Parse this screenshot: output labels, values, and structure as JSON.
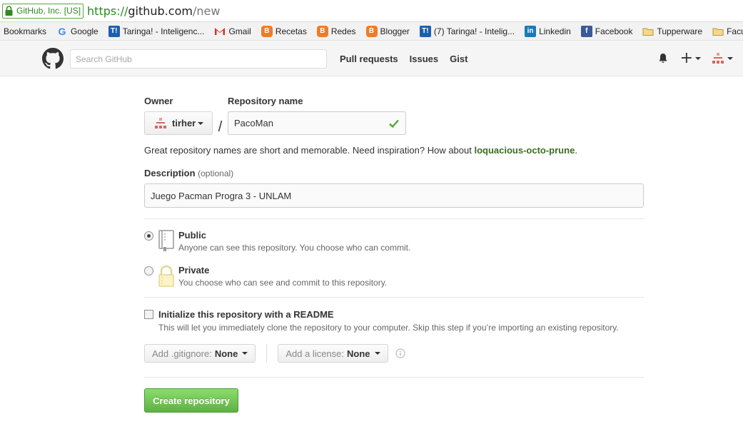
{
  "browser": {
    "security_label": "GitHub, Inc. [US]",
    "url_scheme": "https://",
    "url_host": "github.com",
    "url_path": "/new"
  },
  "bookmarks": [
    {
      "label": "Bookmarks",
      "icon": "none"
    },
    {
      "label": "Google",
      "icon": "google-icon"
    },
    {
      "label": "Taringa! - Inteligenc...",
      "icon": "taringa-icon"
    },
    {
      "label": "Gmail",
      "icon": "gmail-icon"
    },
    {
      "label": "Recetas",
      "icon": "blogger-icon"
    },
    {
      "label": "Redes",
      "icon": "blogger-icon"
    },
    {
      "label": "Blogger",
      "icon": "blogger-icon"
    },
    {
      "label": "(7) Taringa! - Intelig...",
      "icon": "taringa-icon"
    },
    {
      "label": "Linkedin",
      "icon": "linkedin-icon"
    },
    {
      "label": "Facebook",
      "icon": "facebook-icon"
    },
    {
      "label": "Tupperware",
      "icon": "folder-icon"
    },
    {
      "label": "Facult",
      "icon": "folder-icon"
    }
  ],
  "header": {
    "search_placeholder": "Search GitHub",
    "nav": [
      "Pull requests",
      "Issues",
      "Gist"
    ]
  },
  "form": {
    "owner_label": "Owner",
    "owner_value": "tirher",
    "repo_label": "Repository name",
    "repo_value": "PacoMan",
    "slash": "/",
    "hint_text": "Great repository names are short and memorable. Need inspiration? How about ",
    "hint_suggestion": "loquacious-octo-prune",
    "hint_end": ".",
    "description_label": "Description",
    "description_optional": "(optional)",
    "description_value": "Juego Pacman Progra 3 - UNLAM",
    "public_title": "Public",
    "public_desc": "Anyone can see this repository. You choose who can commit.",
    "private_title": "Private",
    "private_desc": "You choose who can see and commit to this repository.",
    "visibility_selected": "Public",
    "readme_title": "Initialize this repository with a README",
    "readme_desc": "This will let you immediately clone the repository to your computer. Skip this step if you’re importing an existing repository.",
    "readme_checked": false,
    "gitignore_label": "Add .gitignore:",
    "gitignore_value": "None",
    "license_label": "Add a license:",
    "license_value": "None",
    "submit_label": "Create repository"
  },
  "colors": {
    "accent_green": "#60b044",
    "suggestion": "#3b6e22",
    "secure_green": "#2d8a1f"
  }
}
